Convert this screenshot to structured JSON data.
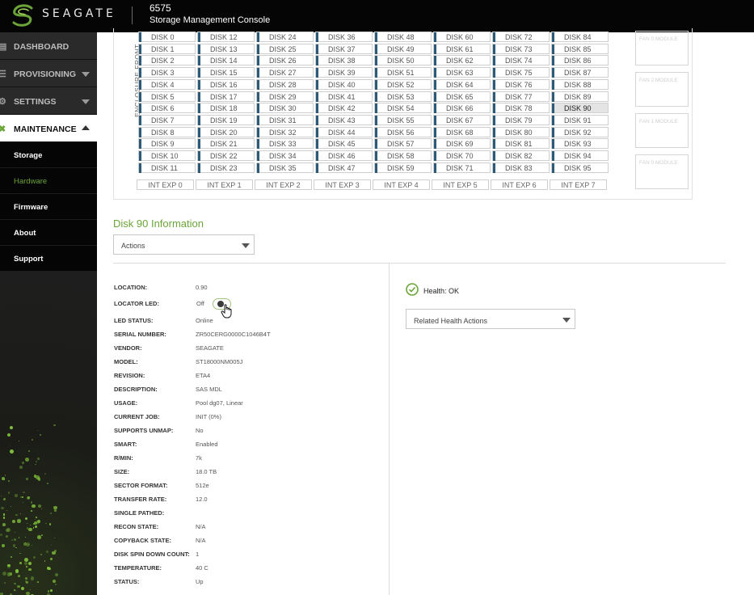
{
  "header": {
    "brand": "SEAGATE",
    "system_id": "6575",
    "console_title": "Storage Management Console"
  },
  "sidebar": {
    "main_items": [
      {
        "label": "DASHBOARD",
        "icon": "dashboard-icon"
      },
      {
        "label": "PROVISIONING",
        "icon": "provisioning-icon"
      },
      {
        "label": "SETTINGS",
        "icon": "gear-icon"
      },
      {
        "label": "MAINTENANCE",
        "icon": "wrench-icon"
      }
    ],
    "sub_items": [
      {
        "label": "Storage"
      },
      {
        "label": "Hardware"
      },
      {
        "label": "Firmware"
      },
      {
        "label": "About"
      },
      {
        "label": "Support"
      }
    ],
    "active_main": "MAINTENANCE",
    "selected_sub": "Hardware"
  },
  "enclosure": {
    "label": "ENCLOSURE FRONT",
    "columns": [
      [
        "DISK 0",
        "DISK 1",
        "DISK 2",
        "DISK 3",
        "DISK 4",
        "DISK 5",
        "DISK 6",
        "DISK 7",
        "DISK 8",
        "DISK 9",
        "DISK 10",
        "DISK 11"
      ],
      [
        "DISK 12",
        "DISK 13",
        "DISK 14",
        "DISK 15",
        "DISK 16",
        "DISK 17",
        "DISK 18",
        "DISK 19",
        "DISK 20",
        "DISK 21",
        "DISK 22",
        "DISK 23"
      ],
      [
        "DISK 24",
        "DISK 25",
        "DISK 26",
        "DISK 27",
        "DISK 28",
        "DISK 29",
        "DISK 30",
        "DISK 31",
        "DISK 32",
        "DISK 33",
        "DISK 34",
        "DISK 35"
      ],
      [
        "DISK 36",
        "DISK 37",
        "DISK 38",
        "DISK 39",
        "DISK 40",
        "DISK 41",
        "DISK 42",
        "DISK 43",
        "DISK 44",
        "DISK 45",
        "DISK 46",
        "DISK 47"
      ],
      [
        "DISK 48",
        "DISK 49",
        "DISK 50",
        "DISK 51",
        "DISK 52",
        "DISK 53",
        "DISK 54",
        "DISK 55",
        "DISK 56",
        "DISK 57",
        "DISK 58",
        "DISK 59"
      ],
      [
        "DISK 60",
        "DISK 61",
        "DISK 62",
        "DISK 63",
        "DISK 64",
        "DISK 65",
        "DISK 66",
        "DISK 67",
        "DISK 68",
        "DISK 69",
        "DISK 70",
        "DISK 71"
      ],
      [
        "DISK 72",
        "DISK 73",
        "DISK 74",
        "DISK 75",
        "DISK 76",
        "DISK 77",
        "DISK 78",
        "DISK 79",
        "DISK 80",
        "DISK 81",
        "DISK 82",
        "DISK 83"
      ],
      [
        "DISK 84",
        "DISK 85",
        "DISK 86",
        "DISK 87",
        "DISK 88",
        "DISK 89",
        "DISK 90",
        "DISK 91",
        "DISK 92",
        "DISK 93",
        "DISK 94",
        "DISK 95"
      ]
    ],
    "selected_disk": "DISK 90",
    "expanders": [
      "INT EXP 0",
      "INT EXP 1",
      "INT EXP 2",
      "INT EXP 3",
      "INT EXP 4",
      "INT EXP 5",
      "INT EXP 6",
      "INT EXP 7"
    ],
    "fan_modules": [
      "FAN 0 MODULE",
      "FAN 2 MODULE",
      "FAN 1 MODULE",
      "FAN 0 MODULE"
    ]
  },
  "disk_info": {
    "title": "Disk 90 Information",
    "actions_label": "Actions",
    "properties": [
      {
        "label": "LOCATION:",
        "value": "0.90"
      },
      {
        "label": "LOCATOR LED:",
        "value": "Off"
      },
      {
        "label": "LED STATUS:",
        "value": "Online"
      },
      {
        "label": "SERIAL NUMBER:",
        "value": "ZR50CERG0000C1046B4T"
      },
      {
        "label": "VENDOR:",
        "value": "SEAGATE"
      },
      {
        "label": "MODEL:",
        "value": "ST18000NM005J"
      },
      {
        "label": "REVISION:",
        "value": "ETA4"
      },
      {
        "label": "DESCRIPTION:",
        "value": "SAS MDL"
      },
      {
        "label": "USAGE:",
        "value": "Pool dg07, Linear"
      },
      {
        "label": "CURRENT JOB:",
        "value": "INIT (0%)"
      },
      {
        "label": "SUPPORTS UNMAP:",
        "value": "No"
      },
      {
        "label": "SMART:",
        "value": "Enabled"
      },
      {
        "label": "R/MIN:",
        "value": "7k"
      },
      {
        "label": "SIZE:",
        "value": "18.0 TB"
      },
      {
        "label": "SECTOR FORMAT:",
        "value": "512e"
      },
      {
        "label": "TRANSFER RATE:",
        "value": "12.0"
      },
      {
        "label": "SINGLE PATHED:",
        "value": ""
      },
      {
        "label": "RECON STATE:",
        "value": "N/A"
      },
      {
        "label": "COPYBACK STATE:",
        "value": "N/A"
      },
      {
        "label": "DISK SPIN DOWN COUNT:",
        "value": "1"
      },
      {
        "label": "TEMPERATURE:",
        "value": "40 C"
      },
      {
        "label": "STATUS:",
        "value": "Up"
      }
    ],
    "health_text": "Health: OK",
    "health_actions_label": "Related Health Actions"
  },
  "colors": {
    "accent_green": "#6ba539",
    "disk_stripe": "#2b5b78",
    "topbar": "#050505",
    "sidebar": "#1e1e1e"
  }
}
